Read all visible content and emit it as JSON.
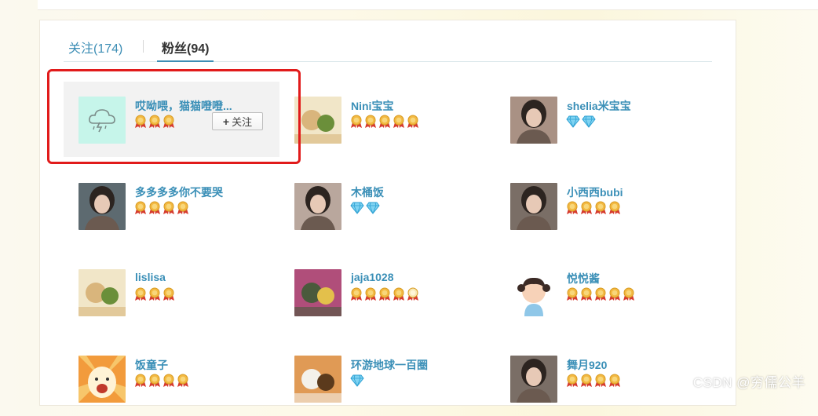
{
  "tabs": {
    "follow_label": "关注(174)",
    "fans_label": "粉丝(94)"
  },
  "follow_button": {
    "plus": "+",
    "label": "关注"
  },
  "watermark": "CSDN @穷儒公羊",
  "colors": {
    "link": "#3a8fb7",
    "tab_active_underline": "#3d8eb5",
    "highlight_card_bg": "#f2f2f2",
    "annotation_box": "#e11b1b"
  },
  "fans": [
    {
      "name": "哎呦喂，猫猫噔噔...",
      "badges": [
        "medal",
        "medal",
        "medal"
      ],
      "avatar": "weather-cloud-icon",
      "highlighted": true,
      "show_follow_button": true
    },
    {
      "name": "Nini宝宝",
      "badges": [
        "medal",
        "medal",
        "medal",
        "medal",
        "medal"
      ],
      "avatar": "food-photo"
    },
    {
      "name": "shelia米宝宝",
      "badges": [
        "diamond",
        "diamond"
      ],
      "avatar": "person-photo"
    },
    {
      "name": "多多多多你不要哭",
      "badges": [
        "medal",
        "medal",
        "medal",
        "medal"
      ],
      "avatar": "person-photo"
    },
    {
      "name": "木桶饭",
      "badges": [
        "diamond",
        "diamond"
      ],
      "avatar": "person-photo"
    },
    {
      "name": "小西西bubi",
      "badges": [
        "medal",
        "medal",
        "medal",
        "medal"
      ],
      "avatar": "person-photo"
    },
    {
      "name": "lislisa",
      "badges": [
        "medal",
        "medal",
        "medal"
      ],
      "avatar": "food-photo"
    },
    {
      "name": "jaja1028",
      "badges": [
        "medal",
        "medal",
        "medal",
        "medal",
        "medal-outline"
      ],
      "avatar": "flowers-photo"
    },
    {
      "name": "悦悦酱",
      "badges": [
        "medal",
        "medal",
        "medal",
        "medal",
        "medal"
      ],
      "avatar": "cartoon-girl"
    },
    {
      "name": "饭童子",
      "badges": [
        "medal",
        "medal",
        "medal",
        "medal"
      ],
      "avatar": "cartoon-face"
    },
    {
      "name": "环游地球一百圈",
      "badges": [
        "diamond"
      ],
      "avatar": "food-bowl-photo"
    },
    {
      "name": "舞月920",
      "badges": [
        "medal",
        "medal",
        "medal",
        "medal"
      ],
      "avatar": "person-photo"
    }
  ]
}
